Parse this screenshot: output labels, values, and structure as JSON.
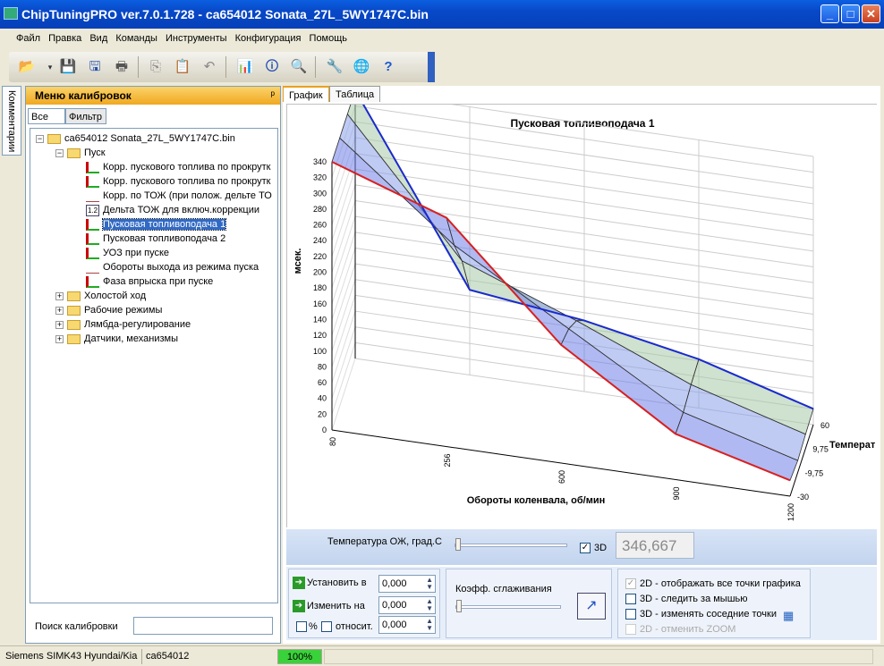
{
  "window": {
    "title": "ChipTuningPRO ver.7.0.1.728 - ca654012 Sonata_27L_5WY1747C.bin",
    "min": "_",
    "max": "□",
    "close": "✕"
  },
  "menu": [
    "Файл",
    "Правка",
    "Вид",
    "Команды",
    "Инструменты",
    "Конфигурация",
    "Помощь"
  ],
  "sidebar": {
    "tab_label": "Комментарии"
  },
  "calib_panel": {
    "title": "Меню калибровок",
    "pin": "ᵖ",
    "filter_all": "Все",
    "filter_tab": "Фильтр",
    "search_label": "Поиск калибровки",
    "search_value": ""
  },
  "tree": {
    "root": "ca654012 Sonata_27L_5WY1747C.bin",
    "group_start": "Пуск",
    "items": [
      "Корр. пускового топлива по прокрутк",
      "Корр. пускового топлива по прокрутк",
      "Корр. по ТОЖ (при полож. дельте ТО",
      "Дельта ТОЖ для включ.коррекции",
      "Пусковая топливоподача 1",
      "Пусковая топливоподача 2",
      "УОЗ при пуске",
      "Обороты выхода из режима пуска",
      "Фаза впрыска при пуске"
    ],
    "groups": [
      "Холостой ход",
      "Рабочие режимы",
      "Лямбда-регулирование",
      "Датчики, механизмы"
    ]
  },
  "view_tabs": [
    "График",
    "Таблица"
  ],
  "chart_data": {
    "type": "surface",
    "title": "Пусковая топливоподача 1",
    "xlabel": "Обороты коленвала, об/мин",
    "ylabel": "мсек.",
    "zlabel": "Температ",
    "x_ticks": [
      "80",
      "256",
      "600",
      "900",
      "1200"
    ],
    "z_ticks": [
      "60",
      "9,75",
      "-9,75",
      "-30"
    ],
    "y_ticks": [
      0,
      20,
      40,
      60,
      80,
      100,
      120,
      140,
      160,
      180,
      200,
      220,
      240,
      260,
      280,
      300,
      320,
      340
    ],
    "series": [
      {
        "name": "",
        "values": [
          340,
          290,
          150,
          58,
          20
        ]
      },
      {
        "name": "",
        "values": [
          340,
          225,
          140,
          55,
          15
        ]
      },
      {
        "name": "",
        "values": [
          340,
          175,
          120,
          60,
          18
        ]
      },
      {
        "name": "",
        "values": [
          340,
          108,
          90,
          62,
          20
        ]
      }
    ]
  },
  "controls": {
    "temp_label": "Температура ОЖ, град.С",
    "temp_slider_pct": 0,
    "check_3d": "3D",
    "temp_value": "346,667",
    "set_label": "Установить в",
    "change_label": "Изменить на",
    "set_value": "0,000",
    "change_value": "0,000",
    "pct_label": "%",
    "rel_label": "относит.",
    "rel_value": "0,000",
    "smooth_label": "Коэфф. сглаживания",
    "opt1": "2D - отображать все точки графика",
    "opt2": "3D - следить за мышью",
    "opt3": "3D - изменять соседние точки",
    "opt4": "2D - отменить ZOOM"
  },
  "status": {
    "ecu": "Siemens SIMK43 Hyundai/Kia",
    "file": "ca654012",
    "progress": "100%"
  }
}
